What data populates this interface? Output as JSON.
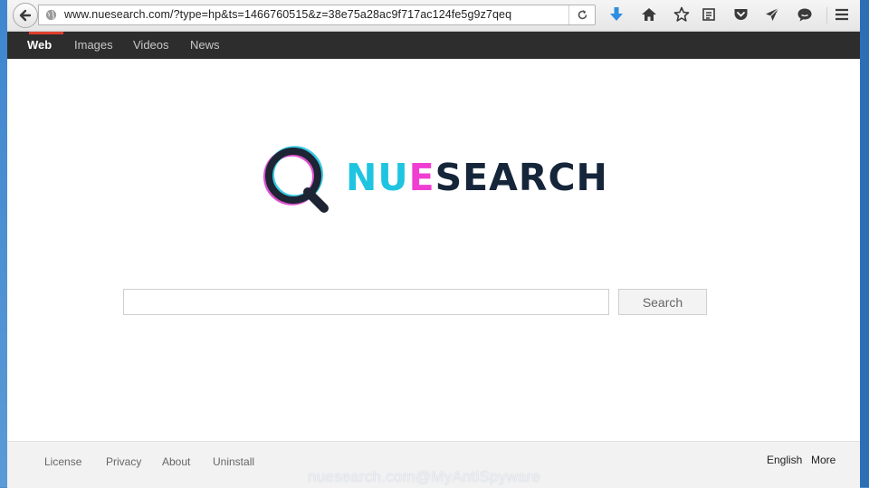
{
  "browser": {
    "url": "www.nuesearch.com/?type=hp&ts=1466760515&z=38e75a28ac9f717ac124fe5g9z7qeq",
    "icons": [
      "back-arrow-icon",
      "globe-icon",
      "reload-icon",
      "download-icon",
      "home-icon",
      "star-icon",
      "reading-list-icon",
      "pocket-icon",
      "send-icon",
      "chat-icon",
      "hamburger-menu-icon"
    ]
  },
  "nav": {
    "items": [
      {
        "label": "Web",
        "active": true
      },
      {
        "label": "Images",
        "active": false
      },
      {
        "label": "Videos",
        "active": false
      },
      {
        "label": "News",
        "active": false
      }
    ],
    "active_color": "#e0402e"
  },
  "logo": {
    "part1": "NU",
    "part2": "E",
    "part3": "SEARCH",
    "colors": {
      "nu": "#1fc4e0",
      "e": "#ef3ed1",
      "rest": "#15253a",
      "q_ring": "#1d2433"
    }
  },
  "search": {
    "value": "",
    "button_label": "Search"
  },
  "footer": {
    "links": [
      "License",
      "Privacy",
      "About",
      "Uninstall"
    ],
    "right": [
      "English",
      "More"
    ]
  },
  "watermark": "nuesearch.com@MyAntiSpyware"
}
